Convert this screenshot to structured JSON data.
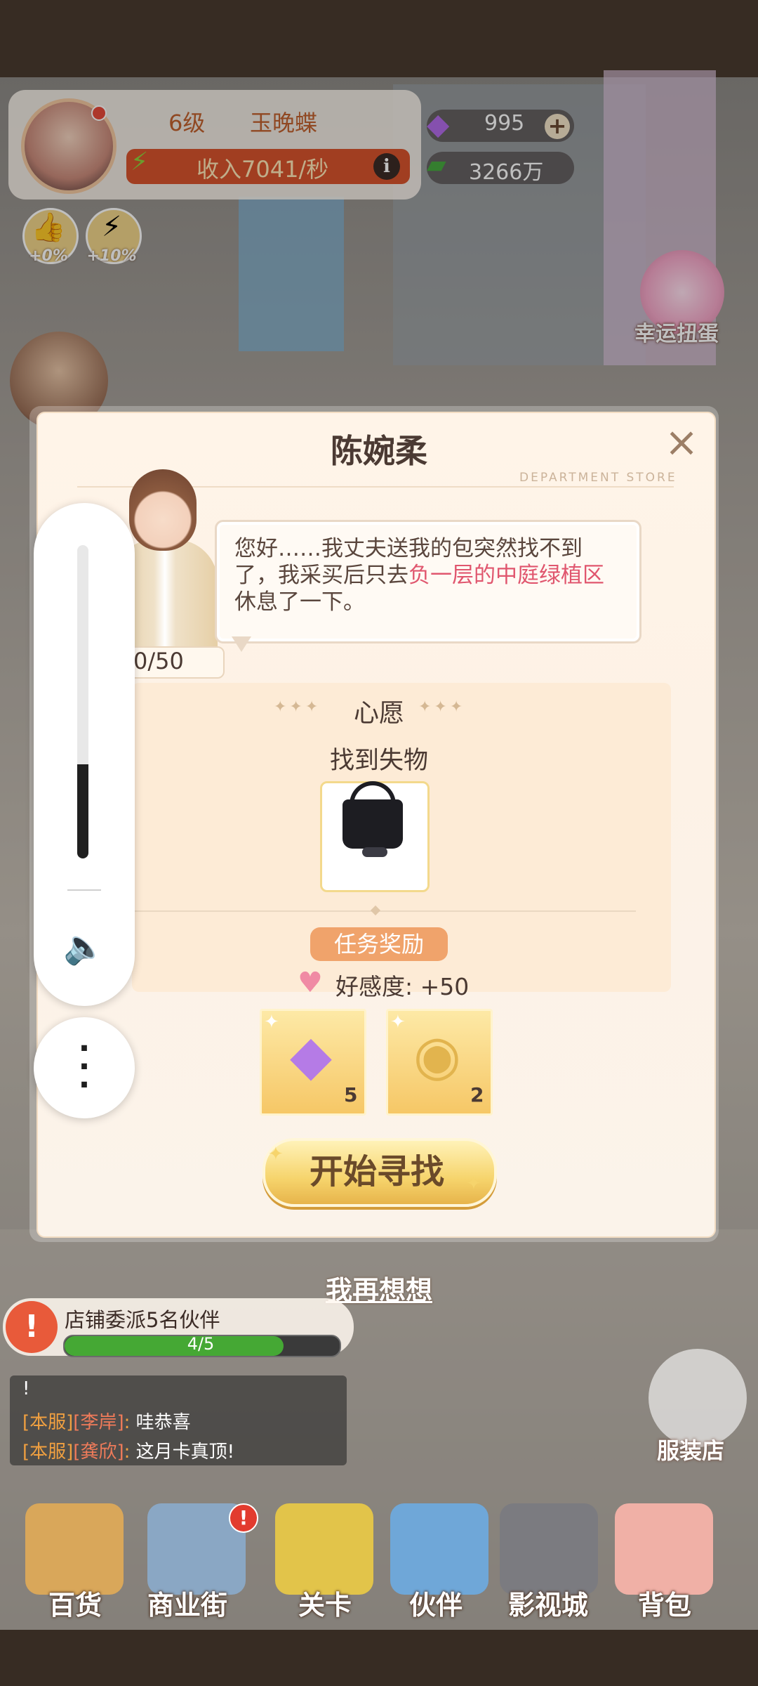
{
  "player": {
    "level": "6级",
    "name": "玉晚蝶",
    "income": "收入7041/秒",
    "info_icon": "i"
  },
  "resources": {
    "gems": "995",
    "cash": "3266万",
    "plus": "+"
  },
  "buffs": [
    {
      "icon": "thumbs-up-icon",
      "value": "+0%"
    },
    {
      "icon": "cash-bolt-icon",
      "value": "+10%"
    }
  ],
  "right_menu": {
    "gacha_label": "幸运扭蛋"
  },
  "dialog": {
    "title": "陈婉柔",
    "subtitle": "DEPARTMENT STORE",
    "close_icon": "×",
    "affinity": "0/50",
    "speech_pre": "您好……我丈夫送我的包突然找不到了，我采买后只去",
    "speech_highlight": "负一层的中庭绿植区",
    "speech_post": "休息了一下。",
    "wish_deco": "✦✦✦",
    "wish_title": "心愿",
    "wish_task": "找到失物",
    "reward_badge": "任务奖励",
    "favor_text": "好感度: +50",
    "rewards": [
      {
        "icon": "purple-gem-icon",
        "qty": "5"
      },
      {
        "icon": "furniture-coin-icon",
        "qty": "2"
      }
    ],
    "start_button": "开始寻找",
    "think_again": "我再想想"
  },
  "volume": {
    "level": 0.3,
    "more": "⋮"
  },
  "quest": {
    "icon": "!",
    "title": "店铺委派5名伙伴",
    "progress_text": "4/5",
    "progress": 0.8
  },
  "chat": {
    "header": "!",
    "lines": [
      {
        "tag": "[本服]",
        "name": "[李岸]",
        "sep": ":",
        "msg": "哇恭喜"
      },
      {
        "tag": "[本服]",
        "name": "[龚欣]",
        "sep": ":",
        "msg": "这月卡真顶!"
      }
    ]
  },
  "shop": {
    "label": "服装店"
  },
  "nav": [
    {
      "label": "百货",
      "icon": "department-store-icon"
    },
    {
      "label": "商业街",
      "icon": "commercial-street-icon",
      "alert": "!"
    },
    {
      "label": "关卡",
      "icon": "truck-icon"
    },
    {
      "label": "伙伴",
      "icon": "partner-icon"
    },
    {
      "label": "影视城",
      "icon": "film-reel-icon"
    },
    {
      "label": "背包",
      "icon": "backpack-icon"
    }
  ],
  "colors": {
    "accent_orange": "#d7532c",
    "highlight_pink": "#e0566e",
    "reward_gold": "#f6c766"
  }
}
